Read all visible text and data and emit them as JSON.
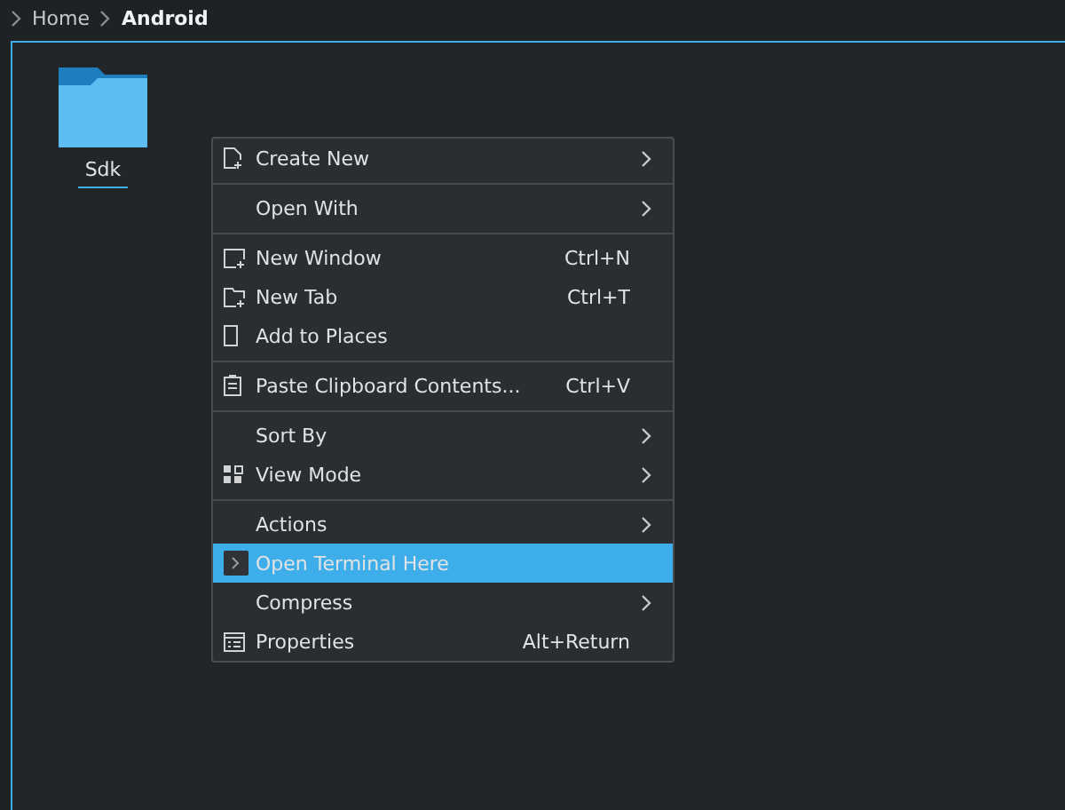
{
  "breadcrumb": [
    {
      "label": "Home",
      "current": false
    },
    {
      "label": "Android",
      "current": true
    }
  ],
  "files": [
    {
      "name": "Sdk",
      "selected": false
    }
  ],
  "context_menu": [
    {
      "kind": "item",
      "label": "Create New",
      "submenu": true,
      "selected": false
    },
    {
      "kind": "separator"
    },
    {
      "kind": "item",
      "label": "Open With",
      "submenu": true,
      "selected": false
    },
    {
      "kind": "separator"
    },
    {
      "kind": "item",
      "label": "New Window",
      "shortcut": "Ctrl+N",
      "selected": false
    },
    {
      "kind": "item",
      "label": "New Tab",
      "shortcut": "Ctrl+T",
      "selected": false
    },
    {
      "kind": "item",
      "label": "Add to Places",
      "selected": false
    },
    {
      "kind": "separator"
    },
    {
      "kind": "item",
      "label": "Paste Clipboard Contents...",
      "shortcut": "Ctrl+V",
      "selected": false
    },
    {
      "kind": "separator"
    },
    {
      "kind": "item",
      "label": "Sort By",
      "submenu": true,
      "selected": false
    },
    {
      "kind": "item",
      "label": "View Mode",
      "submenu": true,
      "selected": false
    },
    {
      "kind": "separator"
    },
    {
      "kind": "item",
      "label": "Actions",
      "submenu": true,
      "selected": false
    },
    {
      "kind": "item",
      "label": "Open Terminal Here",
      "selected": true
    },
    {
      "kind": "item",
      "label": "Compress",
      "submenu": true,
      "selected": false
    },
    {
      "kind": "item",
      "label": "Properties",
      "shortcut": "Alt+Return",
      "selected": false
    }
  ]
}
